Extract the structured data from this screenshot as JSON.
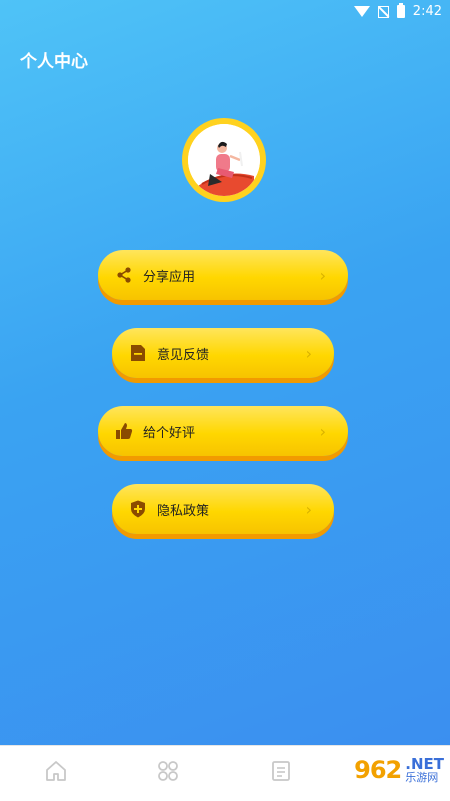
{
  "status_bar": {
    "time": "2:42"
  },
  "header": {
    "title": "个人中心"
  },
  "menu": [
    {
      "label": "分享应用",
      "icon": "share-icon"
    },
    {
      "label": "意见反馈",
      "icon": "feedback-document-icon"
    },
    {
      "label": "给个好评",
      "icon": "thumbs-up-icon"
    },
    {
      "label": "隐私政策",
      "icon": "shield-icon"
    }
  ],
  "chevron": "›",
  "bottom_nav": [
    {
      "icon": "home-icon"
    },
    {
      "icon": "grid-icon"
    },
    {
      "icon": "document-icon"
    }
  ],
  "watermark": {
    "number": "962",
    "net": ".NET",
    "cn": "乐游网"
  },
  "colors": {
    "background_start": "#4fc3f7",
    "background_end": "#3b8ff0",
    "button": "#ffd700",
    "button_shadow": "#f29a00",
    "icon_brown": "#8a4b00"
  }
}
